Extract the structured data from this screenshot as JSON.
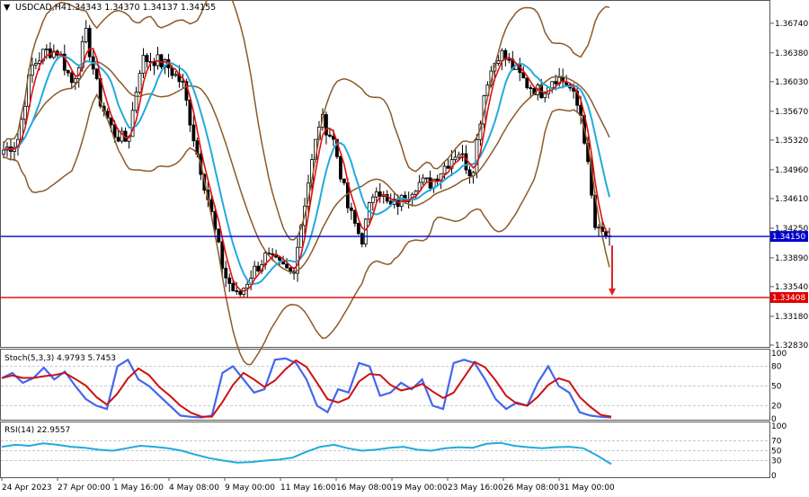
{
  "header": {
    "menu_icon": "triangle-down-icon",
    "symbol_text": "USDCAD,H4",
    "ohlc_text": "1.34343 1.34370 1.34137 1.34155"
  },
  "colors": {
    "candle": "#000000",
    "bollinger": "#8B5A2B",
    "ma_fast": "#e01010",
    "ma_slow": "#22aadd",
    "support_line": "#0000cc",
    "target_line": "#dd0000",
    "arrow": "#dd2222",
    "stoch_main": "#4466ee",
    "stoch_signal": "#cc1111",
    "rsi": "#22aadd",
    "grid": "#c8c8c8",
    "border": "#555555"
  },
  "chart_data": [
    {
      "type": "candlestick",
      "panel": "main",
      "ylim": [
        1.3283,
        1.37
      ],
      "y_ticks": [
        "1.36740",
        "1.36380",
        "1.36030",
        "1.35670",
        "1.35320",
        "1.34960",
        "1.34610",
        "1.34250",
        "1.33890",
        "1.33540",
        "1.33180",
        "1.32830"
      ],
      "x_labels": [
        "24 Apr 2023",
        "27 Apr 00:00",
        "1 May 16:00",
        "4 May 08:00",
        "9 May 00:00",
        "11 May 16:00",
        "16 May 08:00",
        "19 May 00:00",
        "23 May 16:00",
        "26 May 08:00",
        "31 May 00:00"
      ],
      "horizontal_lines": [
        {
          "value": 1.3415,
          "label": "1.34150",
          "color_key": "support_line"
        },
        {
          "value": 1.33408,
          "label": "1.33408",
          "color_key": "target_line"
        }
      ],
      "arrow": {
        "from": 1.3404,
        "to": 1.3343,
        "direction": "down"
      },
      "close_path": [
        1.352,
        1.353,
        1.362,
        1.364,
        1.364,
        1.36,
        1.366,
        1.358,
        1.354,
        1.353,
        1.363,
        1.363,
        1.362,
        1.36,
        1.352,
        1.345,
        1.337,
        1.334,
        1.337,
        1.339,
        1.338,
        1.337,
        1.347,
        1.356,
        1.353,
        1.345,
        1.341,
        1.348,
        1.345,
        1.346,
        1.348,
        1.348,
        1.35,
        1.352,
        1.349,
        1.36,
        1.364,
        1.362,
        1.36,
        1.359,
        1.361,
        1.36,
        1.356,
        1.342,
        1.3415
      ]
    },
    {
      "type": "line",
      "panel": "stochastic",
      "label": "Stoch(5,3,3) 4.9793 5.7453",
      "ylim": [
        0,
        100
      ],
      "y_ticks": [
        "100",
        "80",
        "50",
        "20",
        "0"
      ],
      "series_main": [
        62,
        70,
        55,
        62,
        78,
        60,
        72,
        50,
        30,
        20,
        15,
        80,
        90,
        60,
        50,
        35,
        20,
        5,
        3,
        2,
        5,
        70,
        80,
        60,
        40,
        45,
        90,
        92,
        85,
        60,
        20,
        10,
        45,
        40,
        85,
        80,
        35,
        40,
        55,
        45,
        60,
        20,
        15,
        85,
        90,
        85,
        60,
        30,
        15,
        25,
        20,
        55,
        80,
        50,
        40,
        10,
        5,
        3,
        2
      ]
    },
    {
      "type": "line",
      "panel": "rsi",
      "label": "RSI(14) 22.9557",
      "ylim": [
        0,
        100
      ],
      "y_ticks": [
        "100",
        "70",
        "50",
        "30",
        "0"
      ],
      "series": [
        58,
        62,
        60,
        65,
        62,
        58,
        56,
        52,
        50,
        55,
        60,
        58,
        55,
        50,
        42,
        35,
        30,
        26,
        27,
        30,
        32,
        36,
        48,
        58,
        62,
        55,
        50,
        52,
        56,
        58,
        52,
        50,
        55,
        57,
        56,
        64,
        66,
        60,
        57,
        55,
        57,
        58,
        55,
        40,
        23
      ]
    }
  ]
}
